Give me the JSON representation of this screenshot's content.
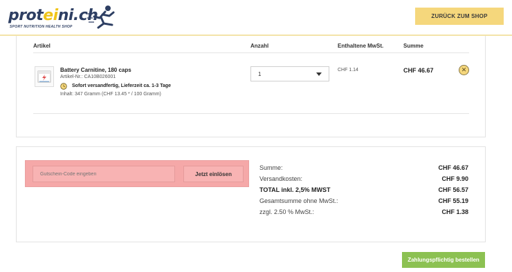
{
  "header": {
    "logo_prefix": "prot",
    "logo_accent": "ei",
    "logo_suffix": "ni.ch",
    "logo_subtitle": "SPORT NUTRITION HEALTH SHOP",
    "back_button": "ZURÜCK ZUM SHOP",
    "brand_color": "#f5d77c"
  },
  "cart": {
    "columns": [
      "Artikel",
      "Anzahl",
      "Enthaltene MwSt.",
      "Summe"
    ],
    "items": [
      {
        "name": "Battery Carnitine, 180 caps",
        "sku": "Artikel-Nr.: CA10B026001",
        "availability": "Sofort versandfertig, Lieferzeit ca. 1-3 Tage",
        "content": "Inhalt: 347 Gramm (CHF 13.45 * / 100 Gramm)",
        "quantity": "1",
        "vat": "CHF 1.14",
        "sum": "CHF 46.67",
        "remove_icon": "close-icon"
      }
    ]
  },
  "voucher": {
    "placeholder": "Gutschein-Code eingeben",
    "button": "Jetzt einlösen"
  },
  "summary": {
    "rows": [
      {
        "label": "Summe:",
        "value": "CHF 46.67"
      },
      {
        "label": "Versandkosten:",
        "value": "CHF 9.90"
      },
      {
        "label": "TOTAL inkl. 2,5% MWST",
        "value": "CHF 56.57"
      },
      {
        "label": "Gesamtsumme ohne MwSt.:",
        "value": "CHF 55.19"
      },
      {
        "label": "zzgl. 2.50 % MwSt.:",
        "value": "CHF 1.38"
      }
    ]
  },
  "order_button": "Zahlungspflichtig bestellen",
  "order_button_color": "#8cc152"
}
